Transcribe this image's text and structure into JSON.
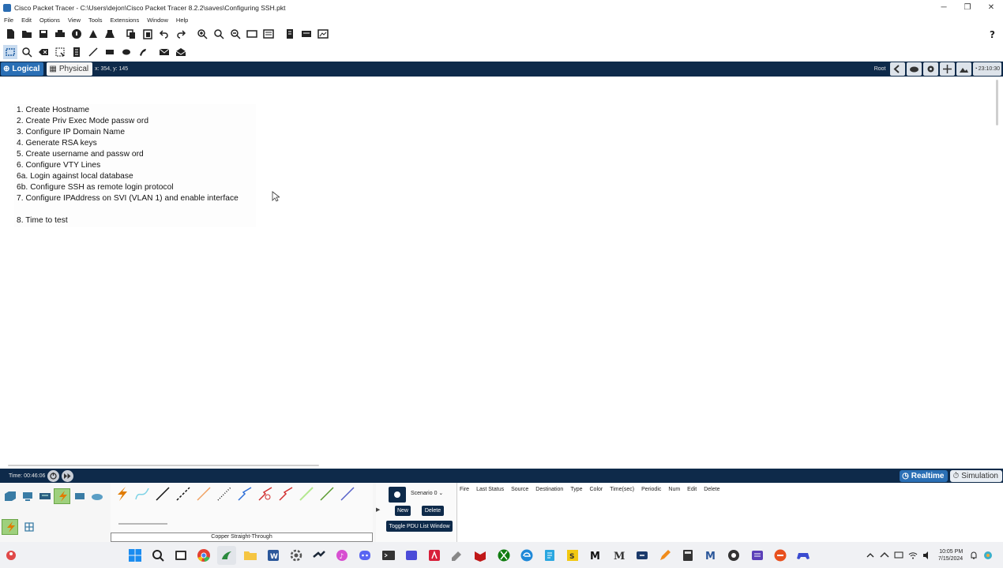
{
  "window": {
    "title": "Cisco Packet Tracer - C:\\Users\\dejon\\Cisco Packet Tracer 8.2.2\\saves\\Configuring SSH.pkt",
    "minimize": "─",
    "restore": "❐",
    "close": "✕"
  },
  "menu": [
    "File",
    "Edit",
    "Options",
    "View",
    "Tools",
    "Extensions",
    "Window",
    "Help"
  ],
  "toolbar_main_icons": [
    "new-file-icon",
    "open-folder-icon",
    "save-icon",
    "print-icon",
    "activity-wizard-icon",
    "network-info-icon",
    "custom-device-icon",
    "copy-icon",
    "paste-icon",
    "undo-icon",
    "redo-icon",
    "zoom-in-icon",
    "zoom-reset-icon",
    "zoom-out-icon",
    "drawing-palette-icon",
    "custom-devices-dialog-icon",
    "viewport-icon",
    "physical-view-icon",
    "help-icon"
  ],
  "toolbar_edit_icons": [
    "select-icon",
    "inspect-icon",
    "delete-icon",
    "resize-icon",
    "place-note-icon",
    "draw-line-icon",
    "draw-rectangle-icon",
    "draw-ellipse-icon",
    "freeform-icon",
    "add-simple-pdu-icon",
    "add-complex-pdu-icon"
  ],
  "workspace_bar": {
    "logical_tab": "Logical",
    "physical_tab": "Physical",
    "coordinates": "x: 354, y: 145",
    "root_label": "Root",
    "time": "23:10:30"
  },
  "notes": {
    "lines": [
      "1. Create Hostname",
      "2. Create Priv Exec Mode passw ord",
      "3. Configure IP Domain Name",
      "4. Generate RSA keys",
      "5. Create username and passw ord",
      "6. Configure VTY Lines",
      " 6a. Login against local database",
      "  6b. Configure SSH as remote login protocol",
      "7. Configure IPAddress on SVI (VLAN 1) and enable interface",
      "8. Time to test"
    ]
  },
  "timebar": {
    "time_label": "Time: 00:46:06",
    "realtime": "Realtime",
    "simulation": "Simulation"
  },
  "devices": {
    "categories": [
      "network-devices-icon",
      "end-devices-icon",
      "components-icon",
      "connections-icon",
      "misc-icon",
      "multiuser-icon"
    ],
    "cables": [
      "automatic-cable-icon",
      "console-cable-icon",
      "copper-straight-through-icon",
      "copper-cross-over-icon",
      "fiber-icon",
      "phone-cable-icon",
      "coaxial-icon",
      "serial-dce-icon",
      "serial-dte-icon",
      "octal-icon",
      "iot-custom-cable-icon",
      "usb-cable-icon"
    ],
    "selected_label": "Copper Straight-Through"
  },
  "scenario": {
    "select": "Scenario 0",
    "new": "New",
    "delete": "Delete",
    "toggle": "Toggle PDU List Window"
  },
  "pdu_table": {
    "headers": [
      "Fire",
      "Last Status",
      "Source",
      "Destination",
      "Type",
      "Color",
      "Time(sec)",
      "Periodic",
      "Num",
      "Edit",
      "Delete"
    ]
  },
  "taskbar": {
    "icons": [
      "windows-start-icon",
      "search-icon",
      "task-view-icon",
      "chrome-icon",
      "packet-tracer-icon",
      "file-explorer-icon",
      "word-icon",
      "gear-icon",
      "steam-icon",
      "itunes-icon",
      "discord-icon",
      "terminal-icon",
      "app-blue-icon",
      "red-app-icon",
      "pen-icon",
      "mcafee-icon",
      "xbox-icon",
      "edge-icon",
      "file-icon",
      "m-app-icon",
      "m-app-2-icon",
      "bolt-icon",
      "pencil-icon",
      "calculator-icon",
      "m-blue-icon",
      "obs-icon",
      "purple-app-icon",
      "orange-app-icon",
      "controller-icon"
    ],
    "time": "10:05 PM",
    "date": "7/15/2024"
  }
}
